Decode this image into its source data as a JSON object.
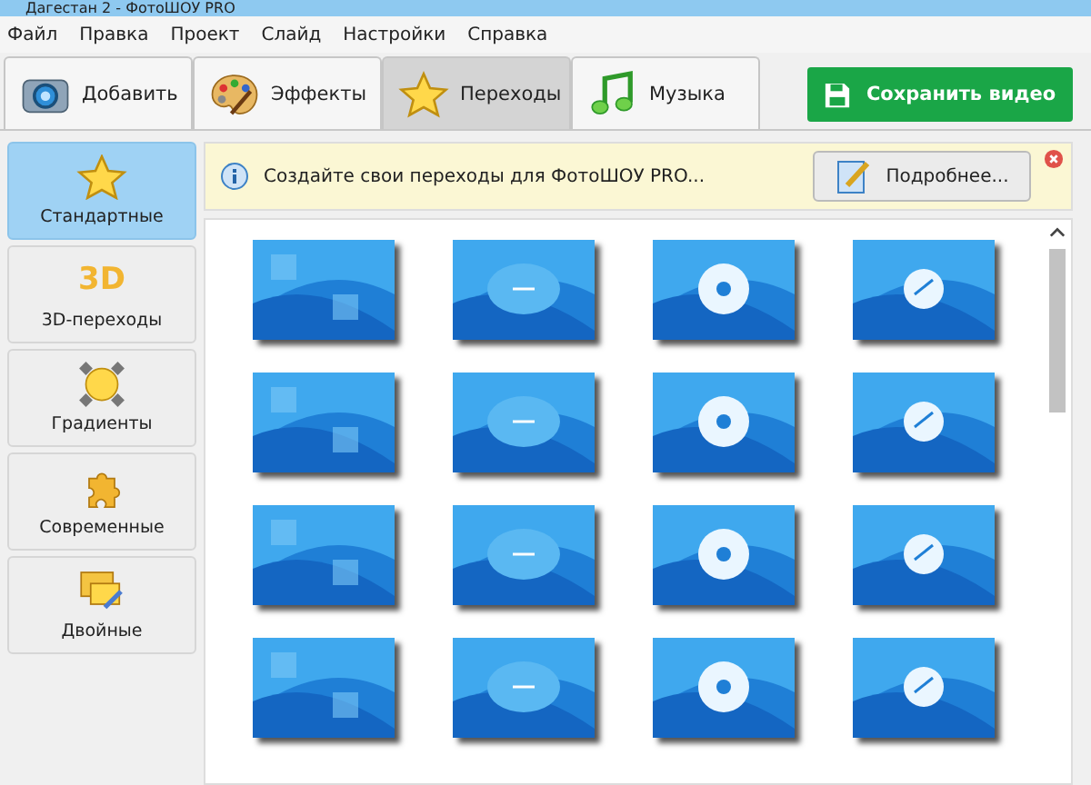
{
  "window": {
    "title": "Дагестан 2 - ФотоШОУ PRO"
  },
  "menu": [
    "Файл",
    "Правка",
    "Проект",
    "Слайд",
    "Настройки",
    "Справка"
  ],
  "tabs": [
    {
      "label": "Добавить",
      "selected": false
    },
    {
      "label": "Эффекты",
      "selected": false
    },
    {
      "label": "Переходы",
      "selected": true
    },
    {
      "label": "Музыка",
      "selected": false
    }
  ],
  "save_button": "Сохранить видео",
  "categories": [
    {
      "label": "Стандартные",
      "selected": true
    },
    {
      "label": "3D-переходы",
      "icon_text": "3D",
      "selected": false
    },
    {
      "label": "Градиенты",
      "selected": false
    },
    {
      "label": "Современные",
      "selected": false
    },
    {
      "label": "Двойные",
      "selected": false
    }
  ],
  "info_bar": {
    "message": "Создайте свои переходы для ФотоШОУ PRO...",
    "button": "Подробнее..."
  }
}
